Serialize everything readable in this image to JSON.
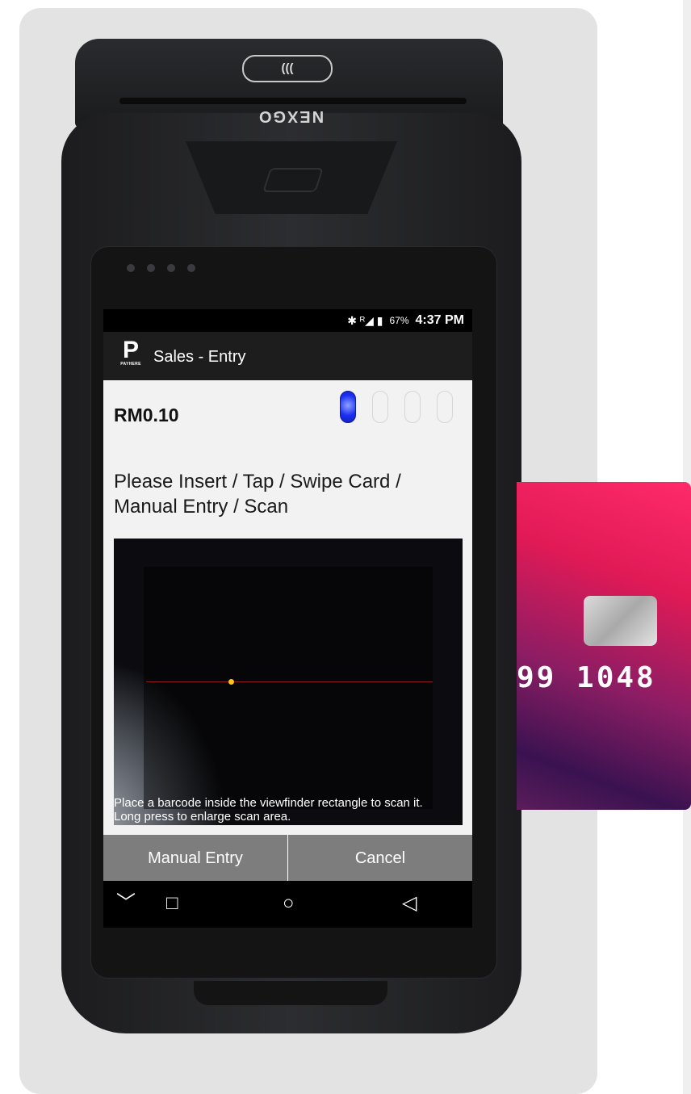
{
  "device": {
    "brand": "NEXGO",
    "nfc_symbol": "((("
  },
  "status_bar": {
    "icons": "✱ ᴿ◢ ▮",
    "battery": "67%",
    "time": "4:37 PM"
  },
  "app_bar": {
    "logo_letter": "P",
    "logo_text": "PAYHERE",
    "title": "Sales - Entry"
  },
  "amount": "RM0.10",
  "progress": {
    "total_steps": 4,
    "active_step": 1
  },
  "instruction": "Please Insert / Tap / Swipe Card / Manual Entry / Scan",
  "scanner": {
    "hint": "Place a barcode inside the viewfinder rectangle to scan it. Long press to enlarge scan area."
  },
  "buttons": {
    "manual_entry": "Manual Entry",
    "cancel": "Cancel"
  },
  "nav": {
    "down": "﹀",
    "recents": "□",
    "home": "○",
    "back": "◁"
  },
  "card": {
    "number_fragment": "99  1048"
  },
  "colors": {
    "app_bar": "#1d1d1d",
    "active_step": "#1c2ff2",
    "action_button": "#7d7d7d",
    "card_accent": "#e01a56"
  }
}
